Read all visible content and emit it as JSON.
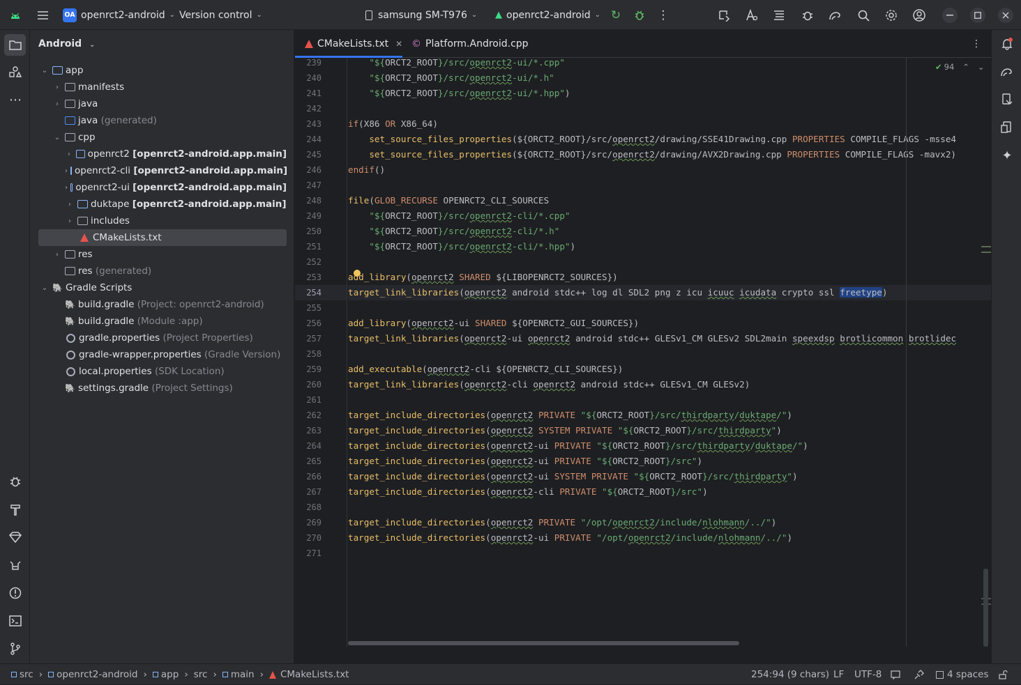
{
  "titlebar": {
    "project_badge": "OA",
    "project_name": "openrct2-android",
    "version_control": "Version control",
    "device": "samsung SM-T976",
    "run_config": "openrct2-android"
  },
  "project_panel": {
    "view_mode": "Android",
    "tree": [
      {
        "label": "app",
        "extra": "",
        "depth": 0,
        "expanded": true
      },
      {
        "label": "manifests",
        "extra": "",
        "depth": 1,
        "expanded": false
      },
      {
        "label": "java",
        "extra": "",
        "depth": 1,
        "expanded": false
      },
      {
        "label": "java",
        "extra": "(generated)",
        "depth": 1,
        "expanded": null
      },
      {
        "label": "cpp",
        "extra": "",
        "depth": 1,
        "expanded": true
      },
      {
        "label": "openrct2",
        "extra": "[openrct2-android.app.main]",
        "depth": 2,
        "expanded": false
      },
      {
        "label": "openrct2-cli",
        "extra": "[openrct2-android.app.main]",
        "depth": 2,
        "expanded": false
      },
      {
        "label": "openrct2-ui",
        "extra": "[openrct2-android.app.main]",
        "depth": 2,
        "expanded": false
      },
      {
        "label": "duktape",
        "extra": "[openrct2-android.app.main]",
        "depth": 2,
        "expanded": false
      },
      {
        "label": "includes",
        "extra": "",
        "depth": 2,
        "expanded": false
      },
      {
        "label": "CMakeLists.txt",
        "extra": "",
        "depth": 2,
        "expanded": null
      },
      {
        "label": "res",
        "extra": "",
        "depth": 1,
        "expanded": false
      },
      {
        "label": "res",
        "extra": "(generated)",
        "depth": 1,
        "expanded": null
      },
      {
        "label": "Gradle Scripts",
        "extra": "",
        "depth": 0,
        "expanded": true
      },
      {
        "label": "build.gradle",
        "extra": "(Project: openrct2-android)",
        "depth": 1,
        "expanded": null
      },
      {
        "label": "build.gradle",
        "extra": "(Module :app)",
        "depth": 1,
        "expanded": null
      },
      {
        "label": "gradle.properties",
        "extra": "(Project Properties)",
        "depth": 1,
        "expanded": null
      },
      {
        "label": "gradle-wrapper.properties",
        "extra": "(Gradle Version)",
        "depth": 1,
        "expanded": null
      },
      {
        "label": "local.properties",
        "extra": "(SDK Location)",
        "depth": 1,
        "expanded": null
      },
      {
        "label": "settings.gradle",
        "extra": "(Project Settings)",
        "depth": 1,
        "expanded": null
      }
    ]
  },
  "editor": {
    "tabs": [
      {
        "label": "CMakeLists.txt",
        "active": true
      },
      {
        "label": "Platform.Android.cpp",
        "active": false
      }
    ],
    "inspection_count": "94",
    "line_numbers": [
      "239",
      "240",
      "241",
      "242",
      "243",
      "244",
      "245",
      "246",
      "247",
      "248",
      "249",
      "250",
      "251",
      "252",
      "253",
      "254",
      "255",
      "256",
      "257",
      "258",
      "259",
      "260",
      "261",
      "262",
      "263",
      "264",
      "265",
      "266",
      "267",
      "268",
      "269",
      "270",
      "271"
    ],
    "current_line": "254"
  },
  "statusbar": {
    "breadcrumbs": [
      "src",
      "openrct2-android",
      "app",
      "src",
      "main",
      "CMakeLists.txt"
    ],
    "position": "254:94 (9 chars)",
    "line_ending": "LF",
    "encoding": "UTF-8",
    "indent": "4 spaces"
  },
  "colors": {
    "accent": "#3574f0",
    "function": "#e8bf6a",
    "string": "#6aab73",
    "keyword": "#cf8e6d",
    "variable": "#c77dbb"
  }
}
